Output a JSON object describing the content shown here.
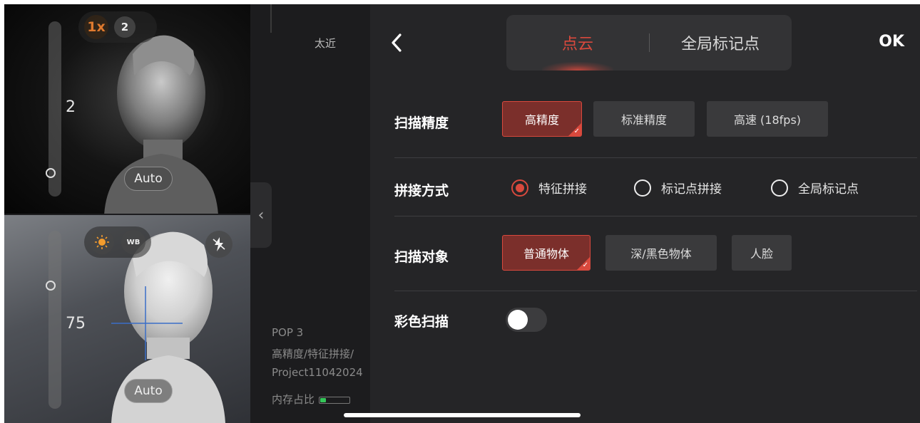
{
  "camera_top": {
    "zoom_options": [
      "1x",
      "2"
    ],
    "selected_zoom": "1x",
    "exposure_value": "2",
    "auto_label": "Auto"
  },
  "camera_bottom": {
    "wb_label": "WB",
    "brightness_value": "75",
    "auto_label": "Auto"
  },
  "status": {
    "distance_hint": "太近",
    "device": "POP 3",
    "mode_summary": "高精度/特征拼接/",
    "project": "Project11042024",
    "memory_label": "内存占比",
    "memory_level": 0.2
  },
  "panel": {
    "ok_label": "OK",
    "tabs": [
      {
        "label": "点云",
        "active": true
      },
      {
        "label": "全局标记点",
        "active": false
      }
    ],
    "precision": {
      "label": "扫描精度",
      "options": [
        "高精度",
        "标准精度",
        "高速 (18fps)"
      ],
      "selected": "高精度"
    },
    "stitching": {
      "label": "拼接方式",
      "options": [
        "特征拼接",
        "标记点拼接",
        "全局标记点"
      ],
      "selected": "特征拼接"
    },
    "object": {
      "label": "扫描对象",
      "options": [
        "普通物体",
        "深/黑色物体",
        "人脸"
      ],
      "selected": "普通物体"
    },
    "color_scan": {
      "label": "彩色扫描",
      "enabled": false
    }
  },
  "colors": {
    "accent": "#d9493d",
    "selected_fill": "#7b2f2b",
    "panel_bg": "#252527",
    "zoom_active": "#e07a2e",
    "memory_fill": "#35c759"
  }
}
